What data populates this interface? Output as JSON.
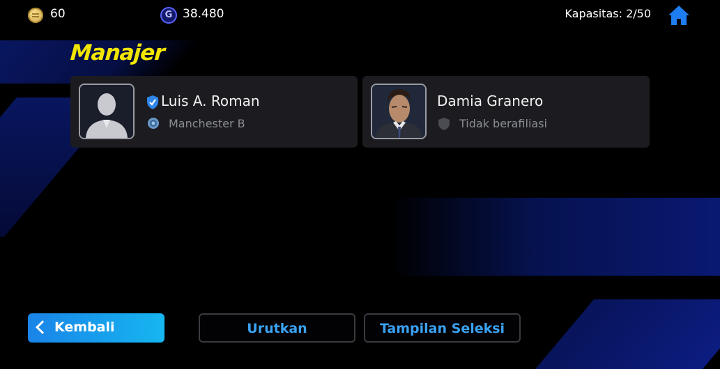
{
  "topbar": {
    "coins": "60",
    "coin_icon": "coin-icon",
    "gp": "38.480",
    "gp_icon_letter": "G",
    "capacity": "Kapasitas: 2/50",
    "home_icon": "home-icon"
  },
  "page": {
    "title": "Manajer"
  },
  "managers": [
    {
      "name": "Luis A. Roman",
      "club": "Manchester B",
      "verified": true,
      "portrait": "silhouette"
    },
    {
      "name": "Damia Granero",
      "club": "Tidak berafiliasi",
      "verified": false,
      "portrait": "photo"
    }
  ],
  "buttons": {
    "back": "Kembali",
    "sort": "Urutkan",
    "view": "Tampilan Seleksi"
  },
  "colors": {
    "title": "#f2e500",
    "accent": "#3aa2f4",
    "back_button": "#1a84e8",
    "card": "#1c1c20"
  }
}
